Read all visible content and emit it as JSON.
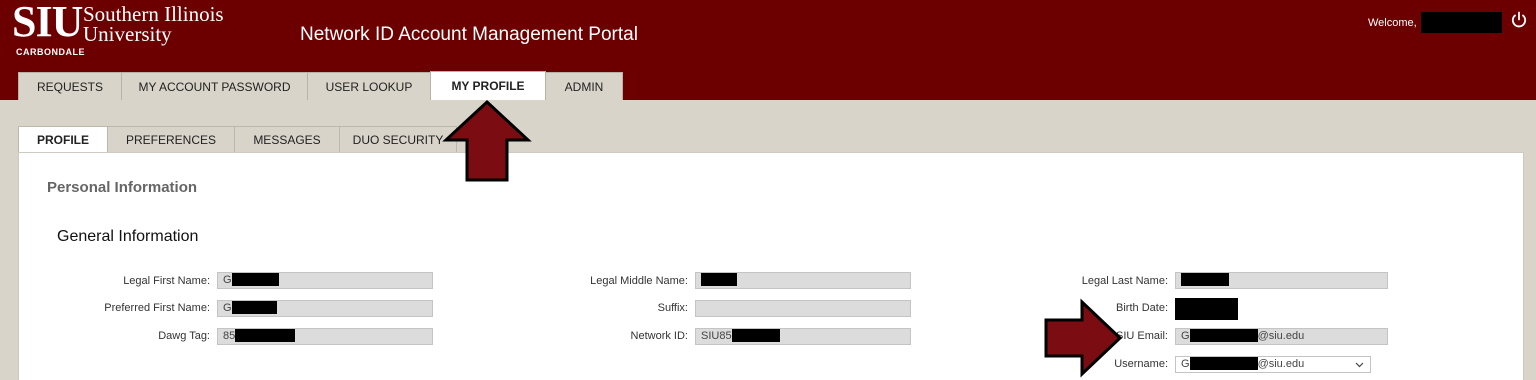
{
  "header": {
    "logo_mark": "SIU",
    "logo_name_line1": "Southern Illinois",
    "logo_name_line2": "University",
    "logo_campus": "CARBONDALE",
    "portal_title": "Network ID Account Management Portal",
    "welcome_text": "Welcome,"
  },
  "top_tabs": [
    {
      "label": "REQUESTS",
      "active": false
    },
    {
      "label": "MY ACCOUNT PASSWORD",
      "active": false
    },
    {
      "label": "USER LOOKUP",
      "active": false
    },
    {
      "label": "MY PROFILE",
      "active": true
    },
    {
      "label": "ADMIN",
      "active": false
    }
  ],
  "sub_tabs": [
    {
      "label": "PROFILE",
      "active": true
    },
    {
      "label": "PREFERENCES",
      "active": false
    },
    {
      "label": "MESSAGES",
      "active": false
    },
    {
      "label": "DUO SECURITY",
      "active": false
    }
  ],
  "section_title": "Personal Information",
  "sub_title": "General Information",
  "fields": {
    "legal_first_name": {
      "label": "Legal First Name:",
      "value_prefix": "G"
    },
    "preferred_first_name": {
      "label": "Preferred First Name:",
      "value_prefix": "G"
    },
    "dawg_tag": {
      "label": "Dawg Tag:",
      "value_prefix": "85"
    },
    "legal_middle_name": {
      "label": "Legal Middle Name:",
      "value_prefix": ""
    },
    "suffix": {
      "label": "Suffix:",
      "value_prefix": ""
    },
    "network_id": {
      "label": "Network ID:",
      "value_prefix": "SIU85"
    },
    "legal_last_name": {
      "label": "Legal Last Name:",
      "value_prefix": ""
    },
    "birth_date": {
      "label": "Birth Date:",
      "value_prefix": ""
    },
    "siu_email": {
      "label": "SIU Email:",
      "value_prefix": "G",
      "value_suffix": "@siu.edu"
    },
    "username": {
      "label": "Username:",
      "value_prefix": "G",
      "value_suffix": "@siu.edu"
    }
  },
  "colors": {
    "brand": "#6c0000",
    "arrow": "#7a0c12"
  }
}
